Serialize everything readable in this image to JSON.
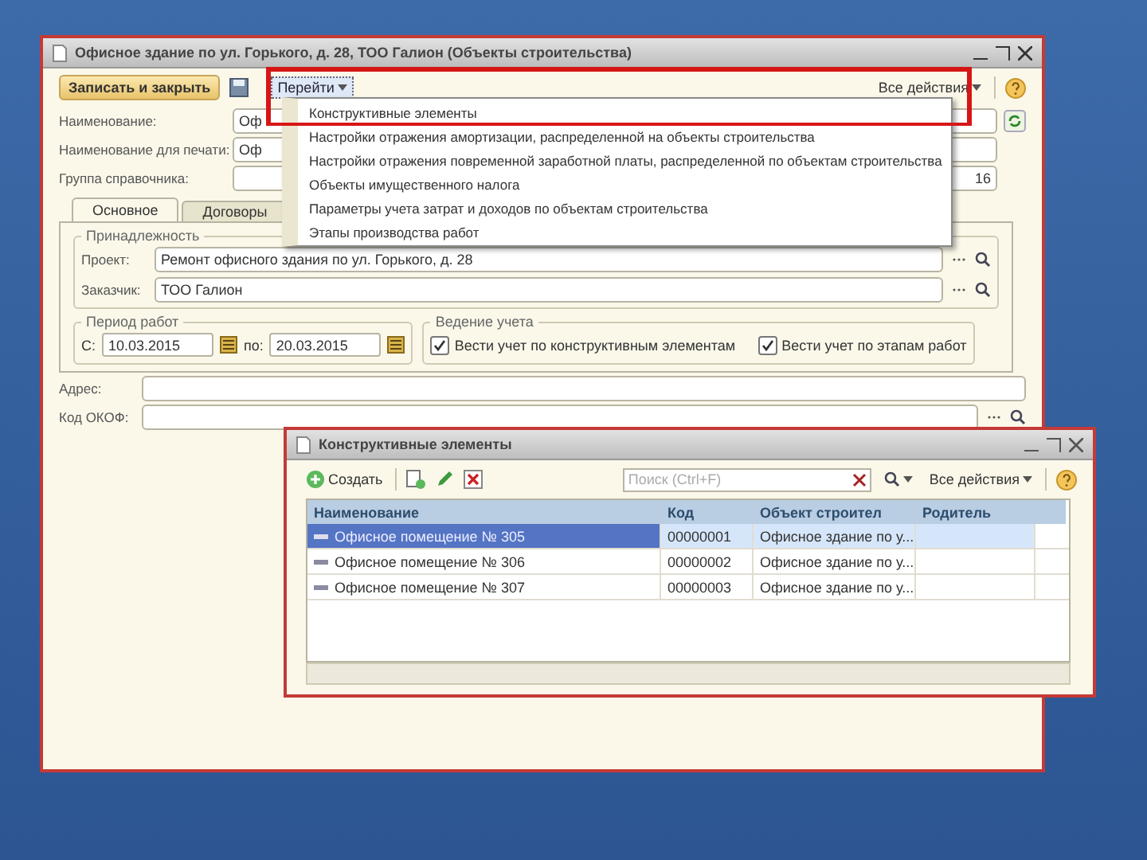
{
  "main_window": {
    "title": "Офисное здание по ул. Горького, д. 28, ТОО Галион (Объекты строительства)",
    "toolbar": {
      "save_close": "Записать и закрыть",
      "goto": "Перейти",
      "all_actions": "Все действия"
    },
    "fields": [
      {
        "label": "Наименование:",
        "value": "Оф",
        "hidden_start": false,
        "refresh": true
      },
      {
        "label": "Наименование для печати:",
        "value": "Оф",
        "hidden_start": false,
        "refresh": false
      },
      {
        "label": "Группа справочника:",
        "value": "16",
        "hidden_start": true,
        "refresh": false
      }
    ],
    "tabs": [
      {
        "label": "Основное",
        "selected": true
      },
      {
        "label": "Договоры",
        "selected": false
      }
    ],
    "membership": {
      "title": "Принадлежность",
      "fields": [
        {
          "label": "Проект:",
          "value": "Ремонт офисного здания по ул. Горького, д. 28"
        },
        {
          "label": "Заказчик:",
          "value": "ТОО Галион"
        }
      ]
    },
    "period": {
      "title": "Период работ",
      "from_label": "С:",
      "from": "10.03.2015",
      "to_label": "по:",
      "to": "20.03.2015"
    },
    "accounting": {
      "title": "Ведение учета",
      "checkboxes": [
        {
          "label": "Вести учет по конструктивным элементам",
          "checked": true
        },
        {
          "label": "Вести учет по этапам работ",
          "checked": true
        }
      ]
    },
    "bottom_fields": [
      {
        "label": "Адрес:",
        "kind": "text"
      },
      {
        "label": "Код ОКОФ:",
        "kind": "lookup"
      }
    ]
  },
  "goto_menu": {
    "items": [
      {
        "label": "Конструктивные элементы"
      },
      {
        "label": "Настройки отражения амортизации, распределенной на объекты строительства"
      },
      {
        "label": "Настройки отражения повременной заработной платы, распределенной по объектам строительства"
      },
      {
        "label": "Объекты имущественного налога"
      },
      {
        "label": "Параметры учета затрат и доходов по объектам строительства"
      },
      {
        "label": "Этапы производства работ"
      }
    ]
  },
  "elements_window": {
    "title": "Конструктивные элементы",
    "create": "Создать",
    "search": {
      "placeholder": "Поиск (Ctrl+F)"
    },
    "all_actions": "Все действия",
    "columns": [
      "Наименование",
      "Код",
      "Объект строител",
      "Родитель"
    ],
    "rows": [
      {
        "name": "Офисное помещение № 305",
        "code": "00000001",
        "object": "Офисное здание по у...",
        "selected": true
      },
      {
        "name": "Офисное помещение № 306",
        "code": "00000002",
        "object": "Офисное здание по у...",
        "selected": false
      },
      {
        "name": "Офисное помещение № 307",
        "code": "00000003",
        "object": "Офисное здание по у...",
        "selected": false
      }
    ]
  }
}
